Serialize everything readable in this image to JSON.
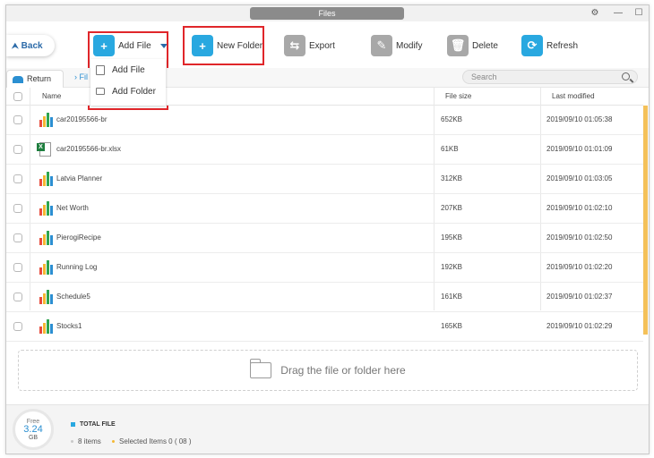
{
  "window": {
    "title": "Files"
  },
  "toolbar": {
    "back_label": "Back",
    "add_file_label": "Add File",
    "new_folder_label": "New Folder",
    "export_label": "Export",
    "modify_label": "Modify",
    "delete_label": "Delete",
    "refresh_label": "Refresh"
  },
  "add_menu": {
    "items": [
      {
        "label": "Add File"
      },
      {
        "label": "Add Folder"
      }
    ]
  },
  "nav": {
    "return_label": "Return",
    "breadcrumb": "Fil",
    "search_placeholder": "Search"
  },
  "table": {
    "columns": {
      "name": "Name",
      "size": "File size",
      "modified": "Last modified"
    },
    "rows": [
      {
        "name": "car20195566-br",
        "size": "652KB",
        "modified": "2019/09/10 01:05:38",
        "icon": "chart-file-icon"
      },
      {
        "name": "car20195566-br.xlsx",
        "size": "61KB",
        "modified": "2019/09/10 01:01:09",
        "icon": "excel-file-icon"
      },
      {
        "name": "Latvia Planner",
        "size": "312KB",
        "modified": "2019/09/10 01:03:05",
        "icon": "chart-file-icon"
      },
      {
        "name": "Net Worth",
        "size": "207KB",
        "modified": "2019/09/10 01:02:10",
        "icon": "chart-file-icon"
      },
      {
        "name": "PierogiRecipe",
        "size": "195KB",
        "modified": "2019/09/10 01:02:50",
        "icon": "chart-file-icon"
      },
      {
        "name": "Running Log",
        "size": "192KB",
        "modified": "2019/09/10 01:02:20",
        "icon": "chart-file-icon"
      },
      {
        "name": "Schedule5",
        "size": "161KB",
        "modified": "2019/09/10 01:02:37",
        "icon": "chart-file-icon"
      },
      {
        "name": "Stocks1",
        "size": "165KB",
        "modified": "2019/09/10 01:02:29",
        "icon": "chart-file-icon"
      }
    ]
  },
  "dropzone": {
    "label": "Drag the file or folder here"
  },
  "footer": {
    "free_label": "Free",
    "free_value": "3.24",
    "free_unit": "GB",
    "total_label": "TOTAL FILE",
    "items_count": "8 items",
    "selected": "Selected Items 0 ( 08 )"
  },
  "colors": {
    "accent": "#29a8e0",
    "highlight_box": "#e0262a",
    "scroll_thumb": "#f4c15a"
  }
}
